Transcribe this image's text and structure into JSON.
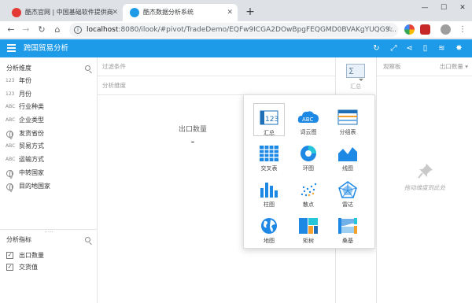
{
  "browser": {
    "tabs": [
      {
        "title": "酷杰官网 | 中国基础软件提供商",
        "active": false
      },
      {
        "title": "酷杰数据分析系统",
        "active": true
      }
    ],
    "url_host": "localhost",
    "url_path": ":8080/ilook/#pivot/TradeDemo/EQFw9ICGA2DOwBpgFEQGMD0BVAKgYUQG9..."
  },
  "app": {
    "title": "跨国贸易分析",
    "accent_color": "#1e9be8",
    "actions": [
      "refresh-icon",
      "fullscreen-icon",
      "share-icon",
      "export-icon",
      "database-icon",
      "settings-icon"
    ]
  },
  "dimensions": {
    "header": "分析维度",
    "items": [
      {
        "type": "123",
        "label": "年份"
      },
      {
        "type": "123",
        "label": "月份"
      },
      {
        "type": "ABC",
        "label": "行业种类"
      },
      {
        "type": "ABC",
        "label": "企业类型"
      },
      {
        "type": "globe",
        "label": "发货省份"
      },
      {
        "type": "ABC",
        "label": "贸易方式"
      },
      {
        "type": "ABC",
        "label": "运输方式"
      },
      {
        "type": "globe",
        "label": "中转国家"
      },
      {
        "type": "globe",
        "label": "目的地国家"
      }
    ]
  },
  "metrics": {
    "header": "分析指标",
    "items": [
      {
        "label": "出口数量",
        "checked": true
      },
      {
        "label": "交货值",
        "checked": true
      }
    ]
  },
  "center": {
    "filter_placeholder": "过滤条件",
    "dimension_placeholder": "分析维度",
    "summary_tile_label": "汇总",
    "value_title": "出口数量",
    "value": "-"
  },
  "chart_types": [
    {
      "label": "汇总",
      "icon": "summary-icon",
      "selected": true
    },
    {
      "label": "词云图",
      "icon": "word-cloud-icon",
      "selected": false
    },
    {
      "label": "分组表",
      "icon": "grouped-table-icon",
      "selected": false
    },
    {
      "label": "交叉表",
      "icon": "crosstab-icon",
      "selected": false
    },
    {
      "label": "环图",
      "icon": "donut-icon",
      "selected": false
    },
    {
      "label": "线图",
      "icon": "line-area-icon",
      "selected": false
    },
    {
      "label": "柱图",
      "icon": "bar-chart-icon",
      "selected": false
    },
    {
      "label": "散点",
      "icon": "scatter-icon",
      "selected": false
    },
    {
      "label": "雷达",
      "icon": "radar-icon",
      "selected": false
    },
    {
      "label": "地图",
      "icon": "map-icon",
      "selected": false
    },
    {
      "label": "矩树",
      "icon": "treemap-icon",
      "selected": false
    },
    {
      "label": "桑基",
      "icon": "sankey-icon",
      "selected": false
    }
  ],
  "right_panel": {
    "header": "观察板",
    "metric_select": "出口数量",
    "drop_hint": "拖动维度到此处"
  }
}
